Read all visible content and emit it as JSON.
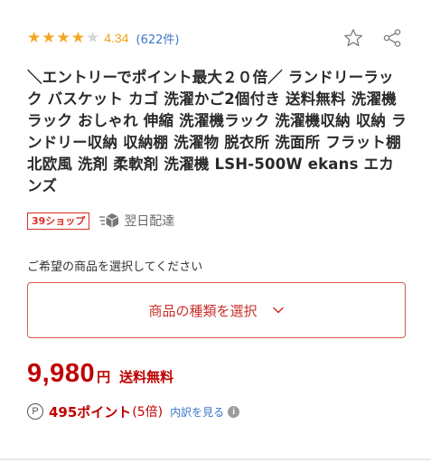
{
  "rating": {
    "stars_filled": 4,
    "stars_total": 5,
    "value": "4.34",
    "review_count": "(622件)"
  },
  "icons": {
    "favorite": "star-outline-icon",
    "share": "share-icon",
    "delivery": "truck-box-icon",
    "points": "p-circle-icon",
    "info": "info-icon",
    "chevron": "chevron-down-icon"
  },
  "product": {
    "title": "＼エントリーでポイント最大２０倍／ ランドリーラック バスケット カゴ 洗濯かご2個付き 送料無料 洗濯機 ラック おしゃれ 伸縮 洗濯機ラック 洗濯機収納 収納 ランドリー収納 収納棚 洗濯物 脱衣所 洗面所 フラット棚 北欧風 洗剤 柔軟剤 洗濯機 LSH-500W ekans エカンズ"
  },
  "badges": {
    "shop": "39ショップ",
    "delivery": "翌日配達"
  },
  "selection": {
    "prompt": "ご希望の商品を選択してください",
    "button_label": "商品の種類を選択"
  },
  "price": {
    "amount": "9,980",
    "currency": "円",
    "shipping": "送料無料"
  },
  "points": {
    "icon_text": "P",
    "amount": "495ポイント",
    "rate": "(5倍)",
    "breakdown_link": "内訳を見る"
  },
  "colors": {
    "star": "#f5a623",
    "link": "#3c76c8",
    "price_red": "#bf0000",
    "badge_red": "#d92e25"
  }
}
